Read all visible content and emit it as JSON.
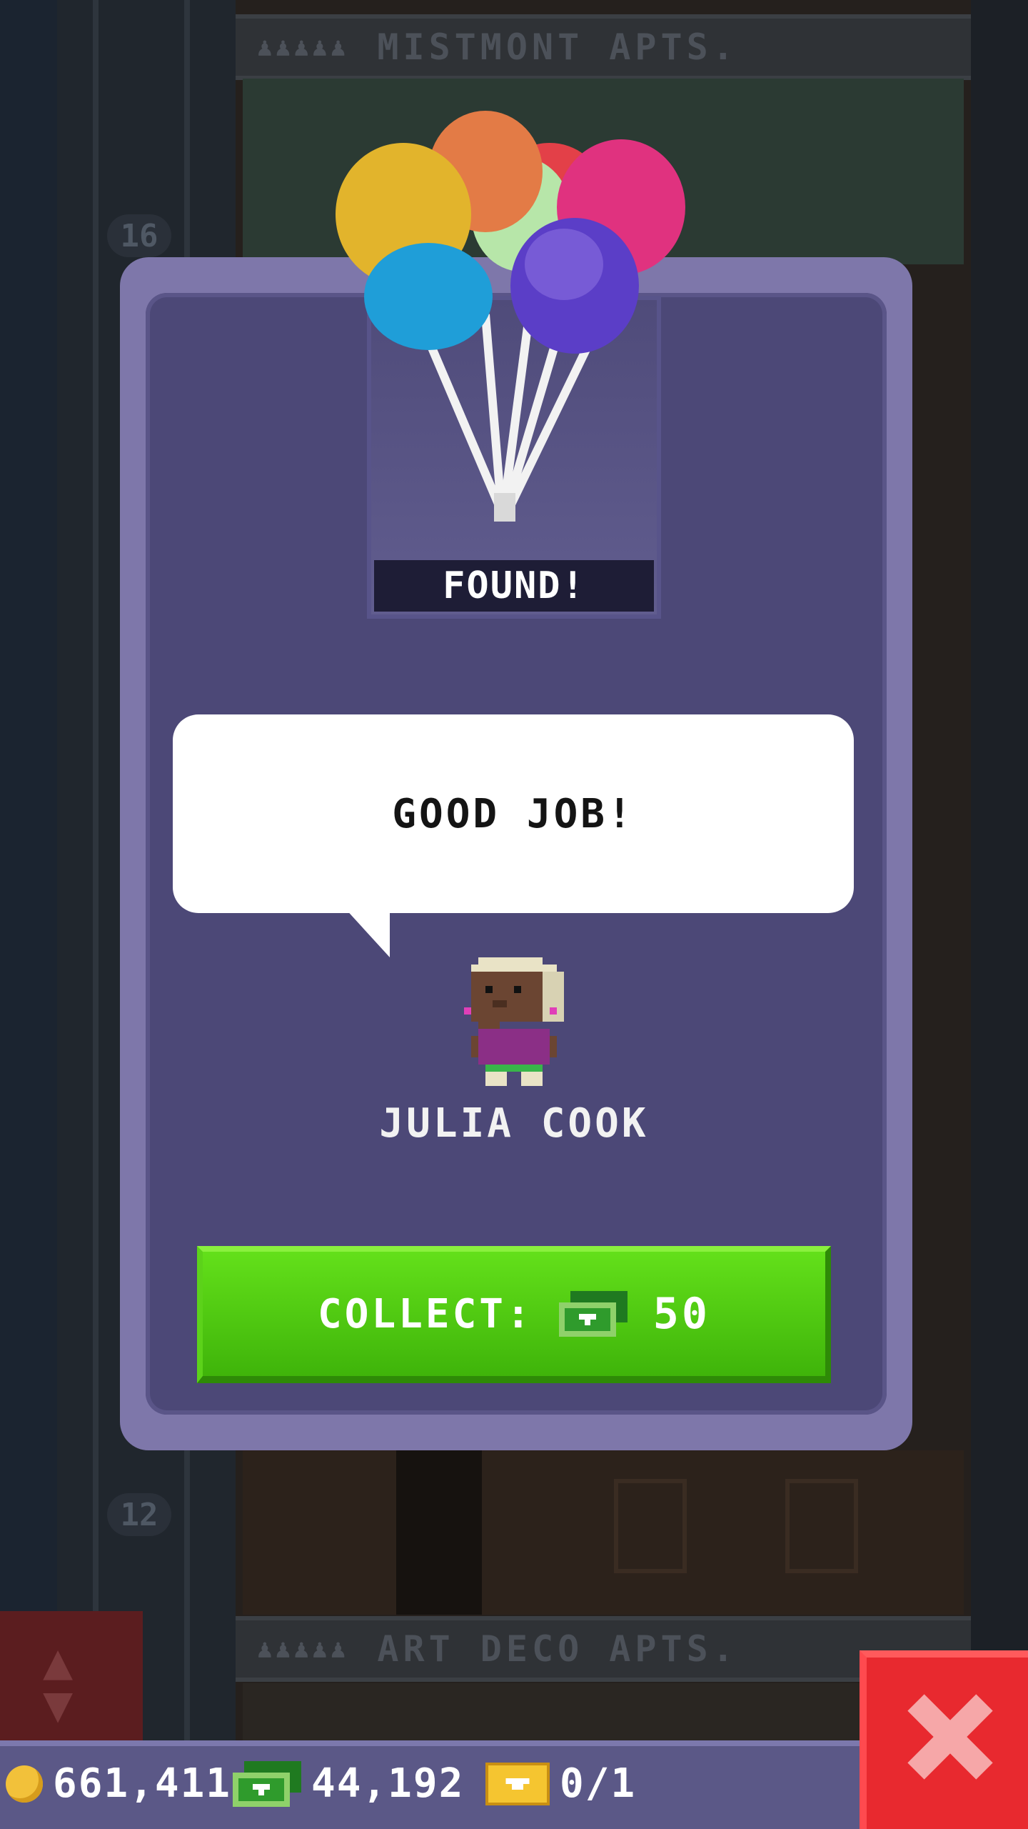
{
  "background": {
    "floors": [
      {
        "name": "MISTMONT APTS.",
        "people": "♟♟♟♟♟"
      },
      {
        "name": "ART DECO APTS.",
        "people": "♟♟♟♟♟"
      }
    ],
    "floor_numbers": [
      "16",
      "12"
    ]
  },
  "modal": {
    "status": "FOUND!",
    "item_icon": "balloons-icon",
    "speech": "GOOD JOB!",
    "character_name": "JULIA COOK",
    "collect": {
      "label": "COLLECT:",
      "currency_icon": "tower-bux-icon",
      "amount": "50"
    }
  },
  "statusbar": {
    "coins": "661,411",
    "bux": "44,192",
    "tickets": "0/1"
  },
  "colors": {
    "modal_frame": "#7e77aa",
    "modal_panel": "#4c4877",
    "collect_green": "#4cc810",
    "close_red": "#e8292f"
  }
}
